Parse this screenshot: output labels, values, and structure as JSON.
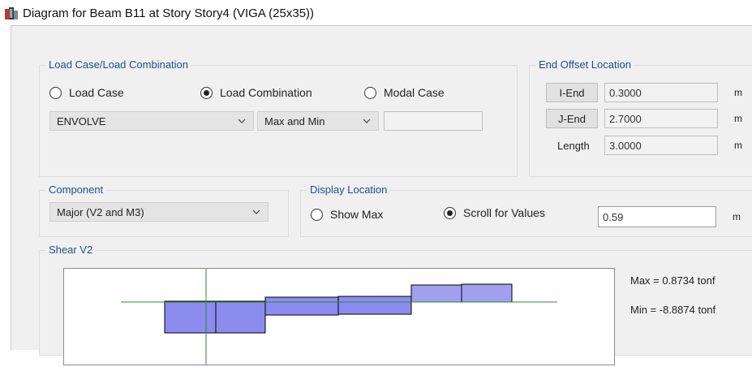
{
  "window": {
    "title": "Diagram for Beam B11 at Story Story4 (VIGA (25x35))",
    "icon": "app-window-icon"
  },
  "load_case": {
    "group_title": "Load Case/Load Combination",
    "options": [
      {
        "label": "Load Case",
        "selected": false
      },
      {
        "label": "Load Combination",
        "selected": true
      },
      {
        "label": "Modal Case",
        "selected": false
      }
    ],
    "combination_select": "ENVOLVE",
    "type_select": "Max and Min",
    "extra_field": ""
  },
  "end_offset": {
    "group_title": "End Offset Location",
    "i_end_label": "I-End",
    "i_end_value": "0.3000",
    "j_end_label": "J-End",
    "j_end_value": "2.7000",
    "length_label": "Length",
    "length_value": "3.0000",
    "unit": "m"
  },
  "component": {
    "group_title": "Component",
    "selected": "Major (V2 and M3)"
  },
  "display_location": {
    "group_title": "Display Location",
    "show_max_label": "Show Max",
    "show_max_selected": false,
    "scroll_label": "Scroll for Values",
    "scroll_selected": true,
    "value": "0.59",
    "unit": "m"
  },
  "shear": {
    "group_title": "Shear V2",
    "max_text": "Max = 0.8734 tonf",
    "min_text": "Min = -8.8874 tonf"
  },
  "colors": {
    "group_title": "#1f4e8c",
    "diagram_fill": "#8b8bf0",
    "diagram_fill_light": "#a0a0ee",
    "axis_line": "#2e8b2e"
  }
}
